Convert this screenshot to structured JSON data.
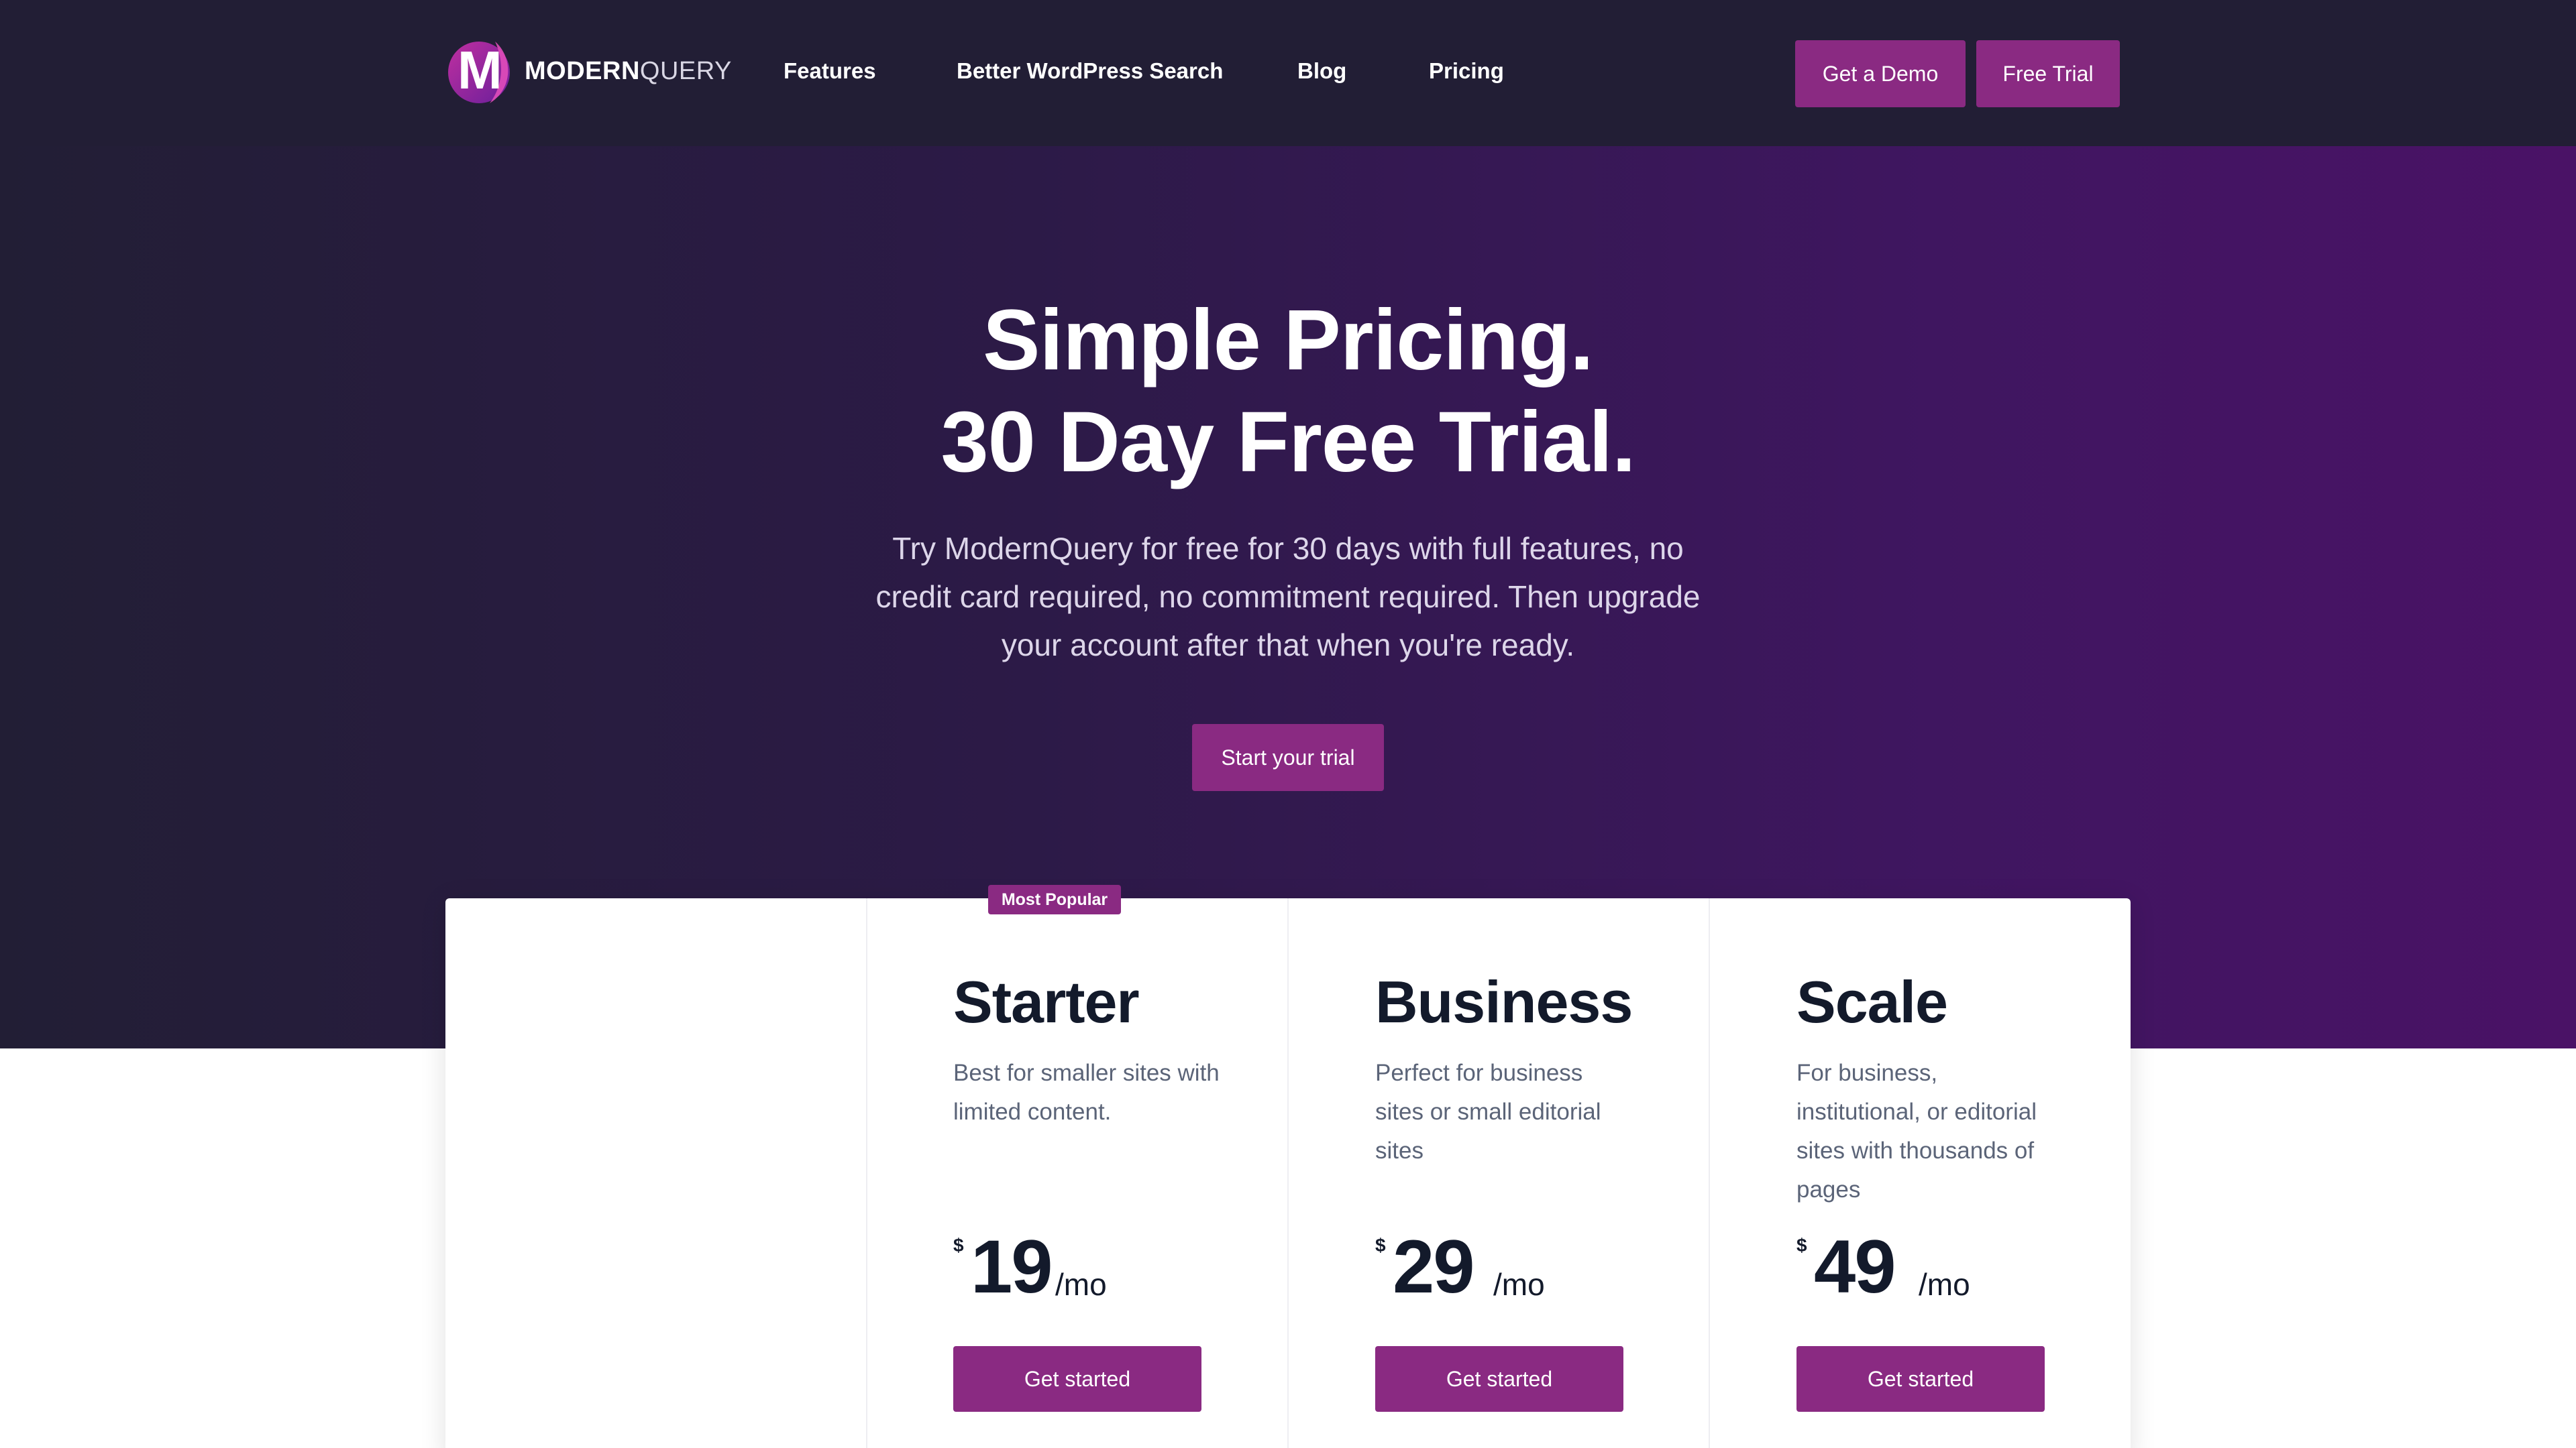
{
  "colors": {
    "nav_bg": "#221e35",
    "accent": "#8a2a82",
    "hero_gradient_start": "#221e35",
    "hero_gradient_end": "#4a1266",
    "heading_dark": "#131a2b",
    "body_muted": "#5b6478"
  },
  "logo": {
    "mark_letter": "M",
    "word_bold": "MODERN",
    "word_light": "QUERY"
  },
  "nav": {
    "links": [
      "Features",
      "Better WordPress Search",
      "Blog",
      "Pricing"
    ],
    "demo_button": "Get a Demo",
    "trial_button": "Free Trial"
  },
  "hero": {
    "title_line1": "Simple Pricing.",
    "title_line2": "30 Day Free Trial.",
    "subtitle": "Try ModernQuery for free for 30 days with full features, no credit card required, no commitment required. Then upgrade your account after that when you're ready.",
    "cta": "Start your trial"
  },
  "pricing": {
    "badge": "Most Popular",
    "plans": [
      {
        "name": "Starter",
        "description": "Best for smaller sites with limited content.",
        "currency": "$",
        "amount": "19",
        "period": "/mo",
        "cta": "Get started"
      },
      {
        "name": "Business",
        "description": "Perfect for business sites or small editorial sites",
        "currency": "$",
        "amount": "29",
        "period": "/mo",
        "cta": "Get started"
      },
      {
        "name": "Scale",
        "description": "For business, institutional, or editorial sites with thousands of pages",
        "currency": "$",
        "amount": "49",
        "period": "/mo",
        "cta": "Get started"
      }
    ]
  }
}
